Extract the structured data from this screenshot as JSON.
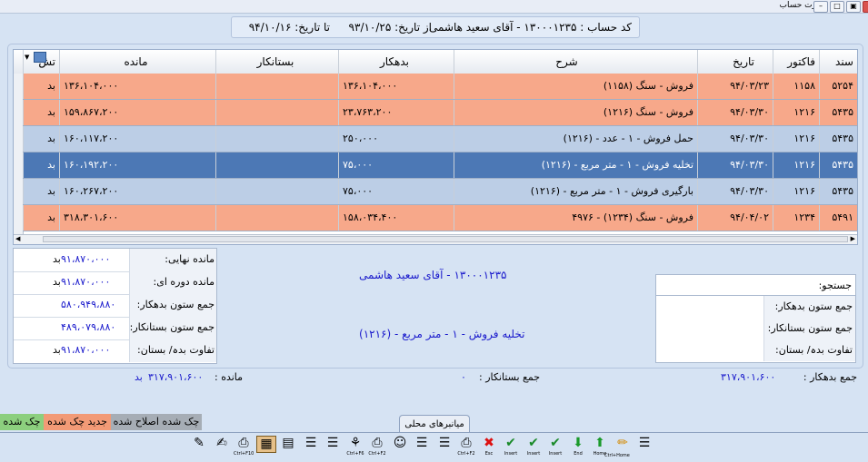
{
  "window": {
    "title": "کارت حساب",
    "buttons": [
      "–",
      "□",
      "▣",
      "×"
    ]
  },
  "header": {
    "account": "کد حساب : ۱۳۰۰۰۱۲۳۵ - آقای سعید هاشمی",
    "from_date": "از تاریخ: ۹۳/۱۰/۲۵",
    "to_date": "تا تاریخ: ۹۴/۱۰/۱۶"
  },
  "grid": {
    "columns": [
      "سند",
      "فاکتور",
      "تاریخ",
      "شرح",
      "بدهکار",
      "بستانکار",
      "مانده",
      "تش"
    ],
    "rows": [
      {
        "doc": "۵۲۵۴",
        "invoice": "۱۱۵۸",
        "date": "۹۴/۰۳/۲۳",
        "desc": "فروش - سنگ (۱۱۵۸)",
        "debit": "۱۳۶،۱۰۴،۰۰۰",
        "credit": "",
        "balance": "۱۳۶،۱۰۴،۰۰۰",
        "status": "بد",
        "style": "orange"
      },
      {
        "doc": "۵۴۳۵",
        "invoice": "۱۲۱۶",
        "date": "۹۴/۰۳/۳۰",
        "desc": "فروش - سنگ (۱۲۱۶)",
        "debit": "۲۳،۷۶۳،۲۰۰",
        "credit": "",
        "balance": "۱۵۹،۸۶۷،۲۰۰",
        "status": "بد",
        "style": "orange"
      },
      {
        "doc": "۵۴۳۵",
        "invoice": "۱۲۱۶",
        "date": "۹۴/۰۳/۳۰",
        "desc": "حمل فروش - ۱ - عدد - (۱۲۱۶)",
        "debit": "۲۵۰،۰۰۰",
        "credit": "",
        "balance": "۱۶۰،۱۱۷،۲۰۰",
        "status": "بد",
        "style": "blue"
      },
      {
        "doc": "۵۴۳۵",
        "invoice": "۱۲۱۶",
        "date": "۹۴/۰۳/۳۰",
        "desc": "تخلیه فروش - ۱ - متر مربع - (۱۲۱۶)",
        "debit": "۷۵،۰۰۰",
        "credit": "",
        "balance": "۱۶۰،۱۹۲،۲۰۰",
        "status": "بد",
        "style": "sel"
      },
      {
        "doc": "۵۴۳۵",
        "invoice": "۱۲۱۶",
        "date": "۹۴/۰۳/۳۰",
        "desc": "بارگیری فروش - ۱ - متر مربع - (۱۲۱۶)",
        "debit": "۷۵،۰۰۰",
        "credit": "",
        "balance": "۱۶۰،۲۶۷،۲۰۰",
        "status": "بد",
        "style": "blue"
      },
      {
        "doc": "۵۴۹۱",
        "invoice": "۱۲۳۴",
        "date": "۹۴/۰۴/۰۲",
        "desc": "فروش - سنگ (۱۲۳۴) - ۴۹۷۶",
        "debit": "۱۵۸،۰۳۴،۴۰۰",
        "credit": "",
        "balance": "۳۱۸،۳۰۱،۶۰۰",
        "status": "بد",
        "style": "orange"
      }
    ]
  },
  "summary_left": [
    {
      "label": "مانده نهایی:",
      "value": "۹۱،۸۷۰،۰۰۰",
      "status": "بد"
    },
    {
      "label": "مانده دوره ای:",
      "value": "۹۱،۸۷۰،۰۰۰",
      "status": "بد"
    },
    {
      "label": "جمع ستون بدهکار:",
      "value": "۵۸۰،۹۴۹،۸۸۰",
      "status": ""
    },
    {
      "label": "جمع ستون بستانکار:",
      "value": "۴۸۹،۰۷۹،۸۸۰",
      "status": ""
    },
    {
      "label": "تفاوت بدہ/ بستان:",
      "value": "۹۱،۸۷۰،۰۰۰",
      "status": "بد"
    }
  ],
  "center": {
    "account": "۱۳۰۰۰۱۲۳۵ - آقای سعید هاشمی",
    "selected_desc": "تخلیه فروش - ۱ - متر مربع - (۱۲۱۶)"
  },
  "search": {
    "title": "جستجو:",
    "rows": [
      "جمع ستون بدهکار:",
      "جمع ستون بستانکار:",
      "تفاوت بدہ/ بستان:"
    ]
  },
  "totals": {
    "debit_label": "جمع بدهکار :",
    "debit_value": "۳۱۷،۹۰۱،۶۰۰",
    "credit_label": "جمع بستانکار :",
    "credit_value": "۰",
    "balance_label": "مانده :",
    "balance_value": "۳۱۷،۹۰۱،۶۰۰",
    "balance_status": "بد"
  },
  "legend": [
    {
      "label": "چک شده اصلاح شده",
      "color": "#a6adb5"
    },
    {
      "label": "جدید چک شده",
      "color": "#f29a76"
    },
    {
      "label": "چک شده",
      "color": "#8ccf7e"
    }
  ],
  "tab": {
    "label": "میانبرهای محلی"
  },
  "toolbar": [
    {
      "icon": "note-icon",
      "glyph": "✎",
      "cap": ""
    },
    {
      "icon": "edit-doc-icon",
      "glyph": "✍",
      "cap": ""
    },
    {
      "icon": "scanner-icon",
      "glyph": "⎙",
      "cap": "Ctrl+F10"
    },
    {
      "icon": "calculator-icon",
      "glyph": "▦",
      "cap": ""
    },
    {
      "icon": "form-icon",
      "glyph": "▤",
      "cap": ""
    },
    {
      "icon": "doc-icon",
      "glyph": "☰",
      "cap": ""
    },
    {
      "icon": "doc2-icon",
      "glyph": "☰",
      "cap": ""
    },
    {
      "icon": "broom-icon",
      "glyph": "⚘",
      "cap": "Ctrl+F6"
    },
    {
      "icon": "printer-icon",
      "glyph": "⎙",
      "cap": "Ctrl+F2"
    },
    {
      "icon": "users-icon",
      "glyph": "☺",
      "cap": ""
    },
    {
      "icon": "list-icon",
      "glyph": "☰",
      "cap": ""
    },
    {
      "icon": "list2-icon",
      "glyph": "☰",
      "cap": ""
    },
    {
      "icon": "print2-icon",
      "glyph": "⎙",
      "cap": "Ctrl+F2"
    },
    {
      "icon": "close-icon",
      "glyph": "✖",
      "cap": "Esc"
    },
    {
      "icon": "check-insert-icon",
      "glyph": "✔",
      "cap": "Insert"
    },
    {
      "icon": "check-insert2-icon",
      "glyph": "✔",
      "cap": "Insert"
    },
    {
      "icon": "check-insert3-icon",
      "glyph": "✔",
      "cap": "Insert"
    },
    {
      "icon": "arrow-down-icon",
      "glyph": "⬇",
      "cap": "End"
    },
    {
      "icon": "arrow-up-icon",
      "glyph": "⬆",
      "cap": "Home"
    },
    {
      "icon": "pencil-icon",
      "glyph": "✏",
      "cap": ""
    },
    {
      "icon": "notes-icon",
      "glyph": "☰",
      "cap": ""
    }
  ],
  "toolbar_extra_caps": {
    "home_sub": "Ctrl+Home"
  }
}
